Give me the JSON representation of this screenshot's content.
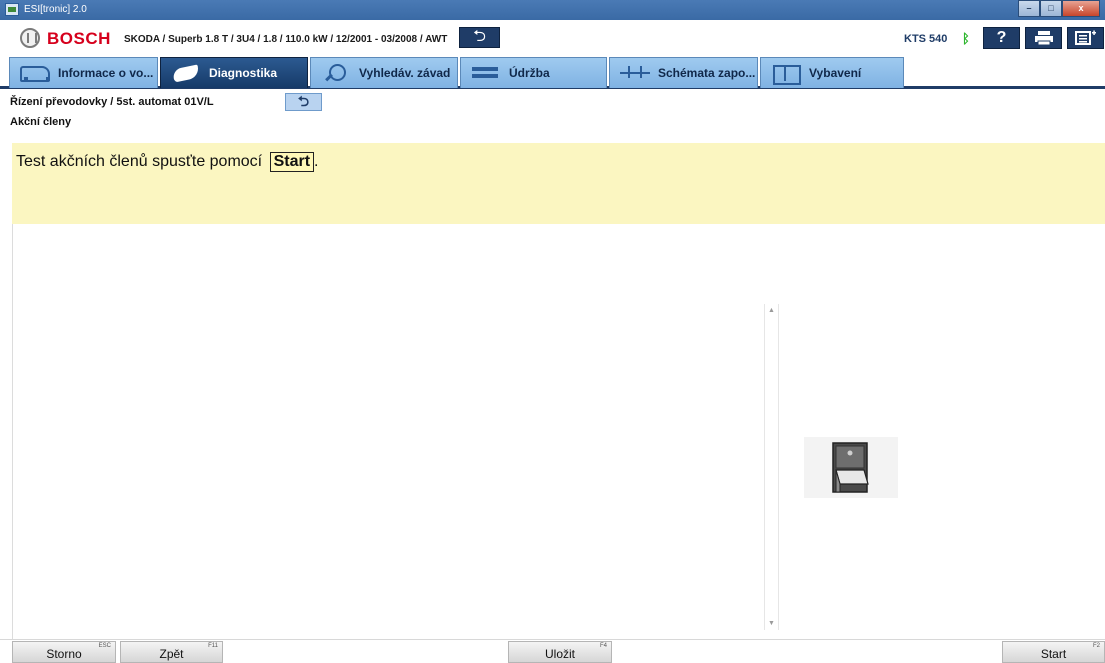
{
  "window": {
    "title": "ESI[tronic] 2.0",
    "controls": [
      "–",
      "□",
      "x"
    ]
  },
  "header": {
    "brand": "BOSCH",
    "vehicle_make": "SKODA / Superb",
    "vehicle_details": " 1.8 T / 3U4 / 1.8 / 110.0 kW / 12/2001 - 03/2008 / AWT",
    "device": "KTS 540",
    "help_label": "?",
    "icons": [
      "bosch-logo-icon",
      "back-arrow-icon",
      "bluetooth-icon",
      "help-icon",
      "print-icon",
      "menu-icon"
    ]
  },
  "tabs": [
    {
      "label": "Informace o vo...",
      "icon": "car-info-icon",
      "active": false
    },
    {
      "label": "Diagnostika",
      "icon": "diagnostics-icon",
      "active": true
    },
    {
      "label": "Vyhledáv. závad",
      "icon": "troubleshooting-icon",
      "active": false
    },
    {
      "label": "Údržba",
      "icon": "maintenance-icon",
      "active": false
    },
    {
      "label": "Schémata zapo...",
      "icon": "wiring-diagram-icon",
      "active": false
    },
    {
      "label": "Vybavení",
      "icon": "equipment-icon",
      "active": false
    }
  ],
  "breadcrumb": {
    "path": "Řízení převodovky / 5st. automat 01V/L",
    "section": "Akční členy"
  },
  "info": {
    "text": "Test akčních členů spusťte pomocí",
    "start_label": "Start",
    "suffix": "."
  },
  "footer": {
    "buttons": [
      {
        "label": "Storno",
        "key": "ESC"
      },
      {
        "label": "Zpět",
        "key": "F11"
      },
      {
        "label": "Uložit",
        "key": "F4"
      },
      {
        "label": "Start",
        "key": "F2"
      }
    ]
  },
  "colors": {
    "brand_red": "#d6001c",
    "nav_dark": "#1f3c67",
    "tab_light": "#9fcaef",
    "info_bg": "#fbf6c1"
  }
}
